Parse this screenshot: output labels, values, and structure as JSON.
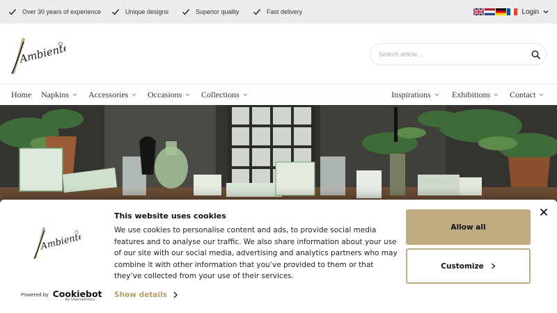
{
  "topbar": {
    "usps": [
      "Over 30 years of experience",
      "Unique designs",
      "Superior quality",
      "Fast delivery"
    ],
    "languages": [
      "English",
      "Dutch",
      "German",
      "French"
    ],
    "login_label": "Login"
  },
  "header": {
    "logo_text": "Ambiente",
    "search_placeholder": "Search article..."
  },
  "nav": {
    "left": [
      "Home",
      "Napkins",
      "Accessories",
      "Occasions",
      "Collections"
    ],
    "right": [
      "Inspirations",
      "Exhibitions",
      "Contact"
    ]
  },
  "cookie": {
    "title": "This website uses cookies",
    "text": "We use cookies to personalise content and ads, to provide social media features and to analyse our traffic. We also share information about your use of our site with our social media, advertising and analytics partners who may combine it with other information that you’ve provided to them or that they’ve collected from your use of their services.",
    "show_details": "Show details",
    "allow_all": "Allow all",
    "customize": "Customize",
    "powered_by": "Powered by",
    "cookiebot": "Cookiebot",
    "cookiebot_sub": "by Usercentrics"
  },
  "colors": {
    "accent": "#c1ab80",
    "link": "#b59c6a",
    "topbar_bg": "#ececec"
  }
}
